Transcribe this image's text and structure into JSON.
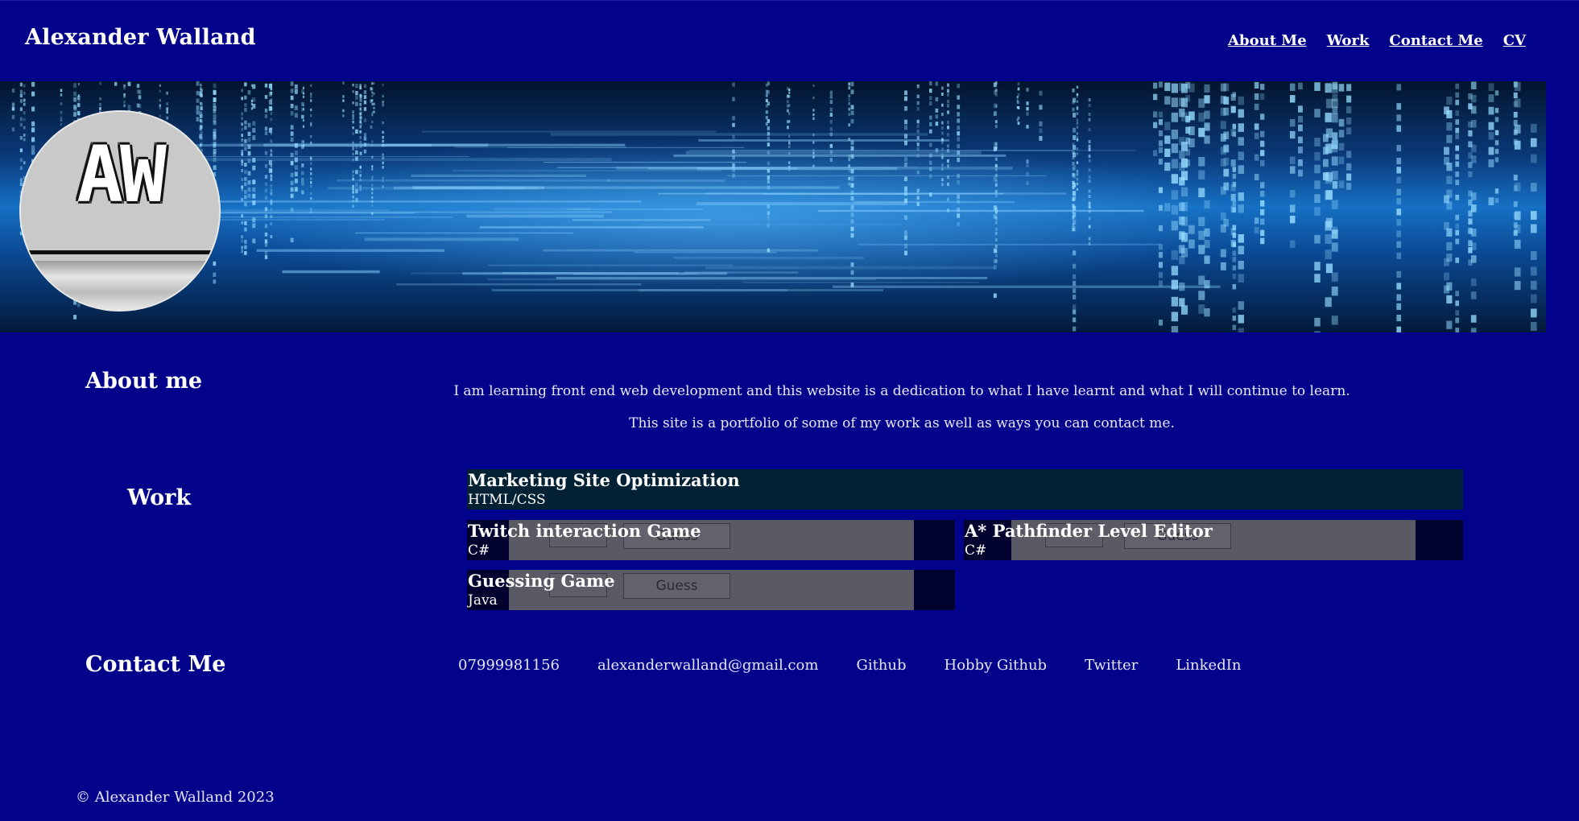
{
  "header": {
    "title": "Alexander Walland",
    "nav": [
      "About Me",
      "Work",
      "Contact Me",
      "CV"
    ]
  },
  "banner": {
    "avatar_text": "AW"
  },
  "about": {
    "heading": "About me",
    "paragraphs": [
      "I am learning front end web development and this website is a dedication to what I have learnt and what I will continue to learn.",
      "This site is a portfolio of some of my work as well as ways you can contact me."
    ]
  },
  "work": {
    "heading": "Work",
    "projects": [
      {
        "title": "Marketing Site Optimization",
        "lang": "HTML/CSS"
      },
      {
        "title": "Twitch interaction Game",
        "lang": "C#",
        "button_label": "Guess"
      },
      {
        "title": "A* Pathfinder Level Editor",
        "lang": "C#",
        "button_label": "Guess"
      },
      {
        "title": "Guessing Game",
        "lang": "Java",
        "button_label": "Guess"
      }
    ]
  },
  "contact": {
    "heading": "Contact Me",
    "items": [
      "07999981156",
      "alexanderwalland@gmail.com",
      "Github",
      "Hobby Github",
      "Twitter",
      "LinkedIn"
    ]
  },
  "footer": {
    "text": "© Alexander Walland 2023"
  },
  "colors": {
    "page_bg": "#02028a",
    "card_bg": "#02022e",
    "card_wide_bg": "#032135"
  }
}
